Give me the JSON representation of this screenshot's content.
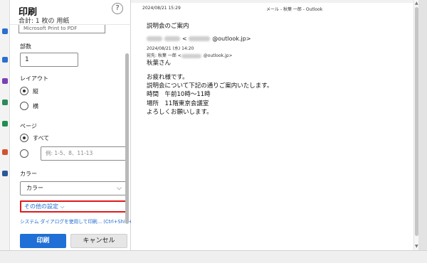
{
  "dialog": {
    "title": "印刷",
    "subtitle": "合計: 1 枚の 用紙",
    "help_label": "?",
    "printer_value": "Microsoft Print to PDF",
    "copies_label": "部数",
    "copies_value": "1",
    "layout_label": "レイアウト",
    "layout_options": [
      "縦",
      "横"
    ],
    "layout_selected": "縦",
    "pages_label": "ページ",
    "pages_options": [
      "すべて"
    ],
    "pages_range_placeholder": "例: 1-5、8、11-13",
    "color_label": "カラー",
    "color_value": "カラー",
    "more_settings": "その他の設定 ⌵",
    "system_dialog": "システム ダイアログを使用して印刷... (Ctrl+Shift+P)",
    "print_button": "印刷",
    "cancel_button": "キャンセル"
  },
  "preview": {
    "header_left": "2024/08/21 15:29",
    "header_right": "メール - 秋葉 一郎 - Outlook",
    "subject": "説明会のご案内",
    "from_suffix": "@outlook.jp>",
    "date": "2024/08/21 (水) 14:20",
    "to_prefix": "宛先: 秋葉 一郎 <",
    "to_suffix": "@outlook.jp>",
    "greeting": "秋葉さん",
    "body": [
      "お疲れ様です。",
      "説明会について下記の通りご案内いたします。",
      "時間　午前10時～11時",
      "場所　11階東京会議室",
      "よろしくお願いします。"
    ]
  }
}
